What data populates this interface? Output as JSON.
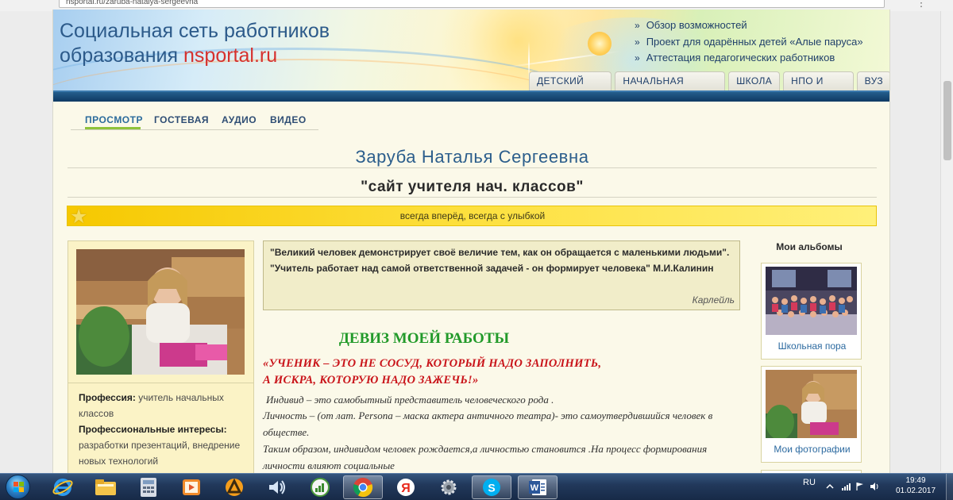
{
  "browser": {
    "url": "nsportal.ru/zaruba-natalya-sergeevna",
    "menu_icon": "menu-icon"
  },
  "site": {
    "title_line1": "Социальная сеть работников",
    "title_line2_prefix": "образования",
    "title_brand": "nsportal.ru",
    "header_links": [
      "Обзор возможностей",
      "Проект для одарённых детей «Алые паруса»",
      "Аттестация педагогических работников"
    ],
    "bullet": "»",
    "edu_tabs": [
      "Детский сад",
      "Начальная школа",
      "Школа",
      "НПО и СПО",
      "ВУЗ"
    ]
  },
  "subnav": [
    "Просмотр",
    "Гостевая",
    "Аудио",
    "Видео"
  ],
  "profile": {
    "name": "Заруба Наталья Сергеевна",
    "site_title": "\"сайт учителя нач. классов\"",
    "motto": "всегда вперёд, всегда с улыбкой",
    "profession_label": "Профессия:",
    "profession_value": "учитель начальных классов",
    "interests_label": "Профессиональные интересы:",
    "interests_value": "разработки презентаций, внедрение новых технологий"
  },
  "quote": {
    "text": "\"Великий человек демонстрирует своё величие тем, как он обращается с маленькими людьми\". \"Учитель работает над самой ответственной задачей - он формирует человека\" М.И.Калинин",
    "author": "Карлейль"
  },
  "work_motto": {
    "heading": "ДЕВИЗ МОЕЙ РАБОТЫ",
    "quote_line1": "«УЧЕНИК – ЭТО НЕ  СОСУД,  КОТОРЫЙ  НАДО  ЗАПОЛНИТЬ,",
    "quote_line2": " А  ИСКРА, КОТОРУЮ  НАДО  ЗАЖЕЧЬ!»",
    "para1": "Индивид – это самобытный представитель человеческого рода .",
    "para2": "Личность – (от лат. Persona – маска актера античного театра)- это самоутвердившийся человек в обществе.",
    "para3": "Таким образом, индивидом человек рождается,а личностью становится .На процесс формирования личности влияют социальные"
  },
  "albums": {
    "title": "Мои альбомы",
    "items": [
      {
        "caption": "Школьная пора"
      },
      {
        "caption": "Мои фотографии"
      }
    ]
  },
  "taskbar": {
    "apps": [
      "start-button",
      "ie-icon",
      "explorer-icon",
      "calculator-icon",
      "media-player-icon",
      "avast-icon",
      "volume-mixer-icon",
      "chart-app-icon",
      "chrome-icon",
      "yandex-icon",
      "tools-icon",
      "skype-icon",
      "word-icon"
    ],
    "lang": "RU",
    "time": "19:49",
    "date": "01.02.2017"
  },
  "colors": {
    "accent_blue": "#2c5e8c",
    "brand_red": "#d6312e",
    "motto_yellow": "#f6c800",
    "heading_green": "#229a2a",
    "quote_red": "#c9141a"
  }
}
